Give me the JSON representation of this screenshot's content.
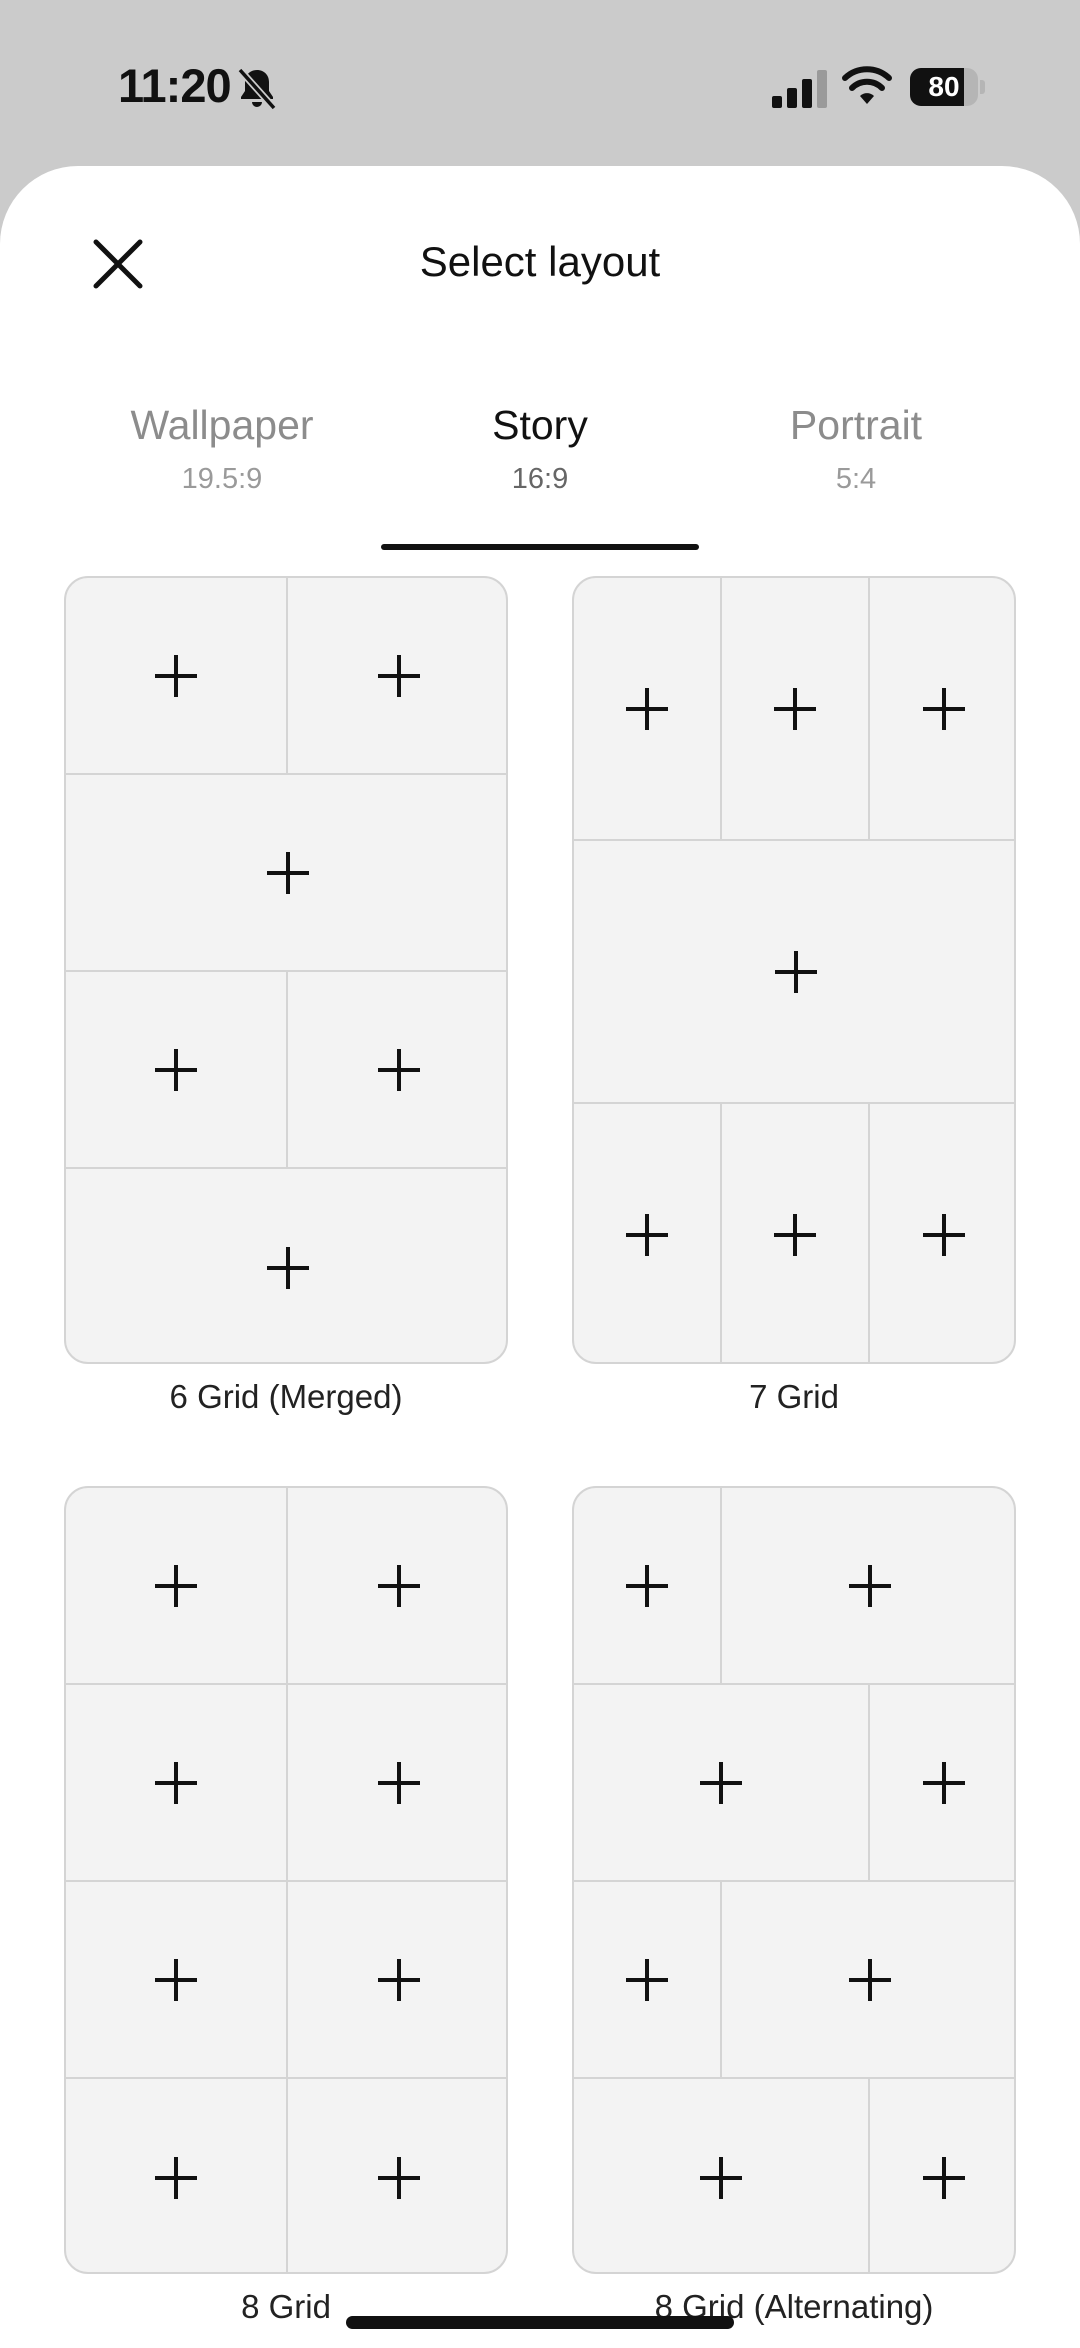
{
  "status_bar": {
    "time": "11:20",
    "battery": "80",
    "battery_level": 0.8
  },
  "header": {
    "title": "Select layout",
    "close_icon": "close-icon"
  },
  "tabs": [
    {
      "label": "Wallpaper",
      "ratio": "19.5:9",
      "active": false
    },
    {
      "label": "Story",
      "ratio": "16:9",
      "active": true
    },
    {
      "label": "Portrait",
      "ratio": "5:4",
      "active": false
    }
  ],
  "layouts": [
    {
      "caption": "6 Grid (Merged)",
      "rows": [
        2,
        1,
        2,
        1
      ]
    },
    {
      "caption": "7 Grid",
      "rows": [
        3,
        1,
        3
      ]
    },
    {
      "caption": "8 Grid",
      "rows": [
        2,
        2,
        2,
        2
      ]
    },
    {
      "caption": "8 Grid (Alternating)",
      "rows": [
        "narrow-wide",
        "wide-narrow",
        "narrow-wide",
        "wide-narrow"
      ]
    }
  ],
  "colors": {
    "accent": "#111111",
    "card_bg": "#f3f3f3",
    "divider": "#d4d4d4",
    "backdrop": "#cbcbcb"
  }
}
